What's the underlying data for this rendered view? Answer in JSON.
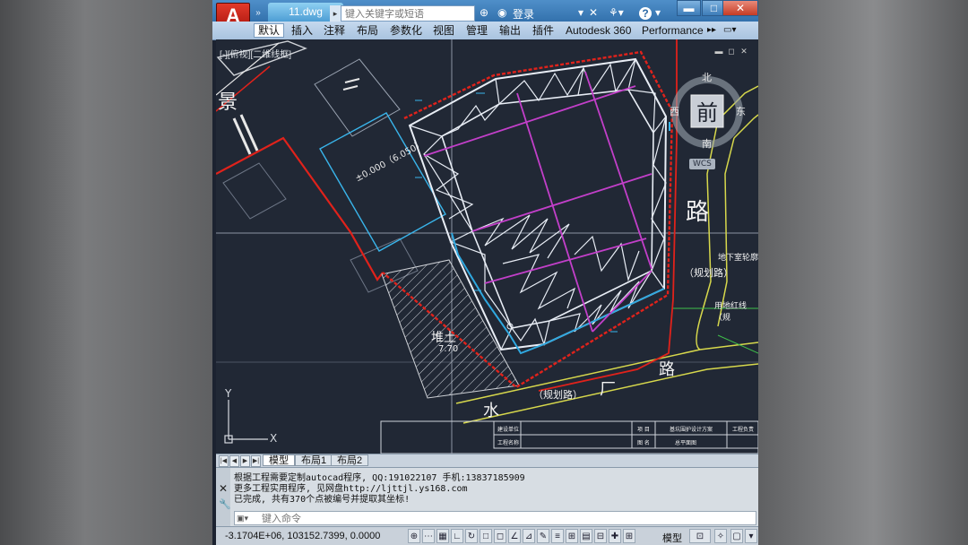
{
  "window": {
    "file_name": "11.dwg",
    "search_placeholder": "键入关键字或短语",
    "login_label": "登录",
    "app_logo": "A",
    "help_label": "?",
    "minimize": "▬",
    "maximize": "□",
    "close": "✕"
  },
  "ribbon": {
    "tabs": [
      "默认",
      "插入",
      "注释",
      "布局",
      "参数化",
      "视图",
      "管理",
      "输出",
      "插件",
      "Autodesk 360",
      "Performance"
    ],
    "active_index": 0
  },
  "viewport": {
    "label": "[-][俯视][二维线框]",
    "viewcube": {
      "face": "前",
      "north": "北",
      "south": "南",
      "west": "西",
      "east": "东",
      "wcs": "WCS"
    },
    "axis_x": "X",
    "axis_y": "Y"
  },
  "drawing_text": {
    "road_ji": "景",
    "road_lu_right": "路",
    "road_lu_bottom": "路",
    "road_chang": "厂",
    "road_shui": "水",
    "planned_road_right": "（规划路）",
    "planned_road_bottom": "（规划路）",
    "duitu": "堆土",
    "duitu_value": "7.70",
    "elevation": "±0.000（6.050）",
    "underground": "地下室轮廓",
    "red_line": "用地红线（规",
    "title_table": {
      "r1c1": "建设单位",
      "r1c2": "项  目",
      "r1c3": "基坑围护设计方案",
      "r1c4": "工程负责",
      "r2c1": "工程名称",
      "r2c2": "图  名",
      "r2c3": "总平面图"
    }
  },
  "layout_tabs": [
    "模型",
    "布局1",
    "布局2"
  ],
  "command": {
    "lines": [
      "根据工程需要定制autocad程序, QQ:191022107  手机:13837185909",
      "更多工程实用程序, 见网盘http://ljttjl.ys168.com",
      "已完成, 共有370个点被编号并提取其坐标!"
    ],
    "placeholder": "键入命令"
  },
  "status": {
    "coordinates": "-3.1704E+06, 103152.7399, 0.0000",
    "model_label": "模型"
  },
  "colors": {
    "titlebar": "#3f7fbf",
    "drawing_bg": "#212835",
    "boundary_red": "#e0221b",
    "truss_white": "#e8edf5",
    "outline_blue": "#2fa8e0",
    "beam_magenta": "#c23fc9",
    "road_yellow": "#d7d84c"
  }
}
